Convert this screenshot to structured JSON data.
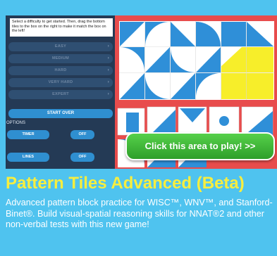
{
  "panel": {
    "instructions": "Select a difficulty to get started. Then, drag the bottom tiles to the box on the right to make it match the box on the left!",
    "difficulties": [
      {
        "label": "EASY"
      },
      {
        "label": "MEDIUM"
      },
      {
        "label": "HARD"
      },
      {
        "label": "VERY HARD"
      },
      {
        "label": "EXPERT"
      }
    ],
    "chevron": "›",
    "start_over": "START OVER",
    "options_label": "OPTIONS",
    "timer_label": "TIMER",
    "timer_value": "OFF",
    "lines_label": "LINES",
    "lines_value": "OFF"
  },
  "play_button": "Click this area to play! >>",
  "title": "Pattern Tiles Advanced (Beta)",
  "description": "Advanced pattern block practice for WISC™, WNV™, and Stanford-Binet®. Build visual-spatial reasoning skills for NNAT®2 and other non-verbal tests with this new game!",
  "colors": {
    "background": "#4fc3ef",
    "board": "#e84c4c",
    "tile_blue": "#2f8fd8",
    "tile_yellow": "#f7ee2a",
    "title_yellow": "#f7ee3f",
    "panel": "#243a55"
  }
}
